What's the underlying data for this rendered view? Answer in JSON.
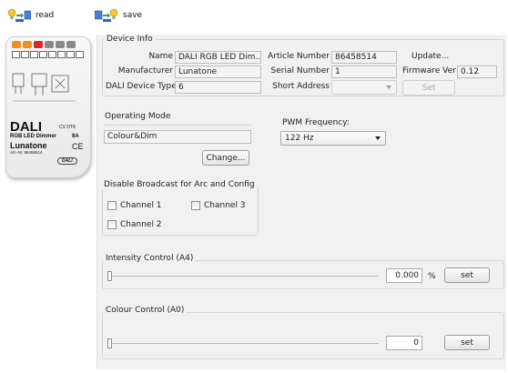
{
  "toolbar": {
    "read_label": "read",
    "save_label": "save"
  },
  "device": {
    "brand": "DALI",
    "type_code": "CV DT8",
    "product": "RGB LED Dimmer",
    "current": "8A",
    "maker": "Lunatone",
    "article": "Art.-Nr. 86458514",
    "ce": "CE",
    "dali_badge": "DALI"
  },
  "device_info": {
    "title": "Device Info",
    "name_label": "Name",
    "name_value": "DALI RGB LED Dim...",
    "manufacturer_label": "Manufacturer",
    "manufacturer_value": "Lunatone",
    "device_type_label": "DALI Device Type",
    "device_type_value": "6",
    "article_label": "Article Number",
    "article_value": "86458514",
    "serial_label": "Serial Number",
    "serial_value": "1",
    "short_address_label": "Short Address",
    "short_address_value": "",
    "update_label": "Update...",
    "firmware_label": "Firmware Ver",
    "firmware_value": "0.12",
    "set_label": "Set"
  },
  "operating_mode": {
    "title": "Operating Mode",
    "value": "Colour&Dim",
    "change_label": "Change..."
  },
  "pwm": {
    "label": "PWM Frequency:",
    "selected": "122 Hz"
  },
  "broadcast": {
    "title": "Disable Broadcast  for Arc and Config",
    "channels": [
      {
        "label": "Channel 1",
        "checked": false
      },
      {
        "label": "Channel 3",
        "checked": false
      },
      {
        "label": "Channel 2",
        "checked": false
      }
    ]
  },
  "intensity": {
    "title": "Intensity Control (A4)",
    "value": "0.000",
    "unit": "%",
    "set_label": "set",
    "slider_level": 0
  },
  "colour": {
    "title": "Colour Control (A0)",
    "value": "0",
    "set_label": "set",
    "slider_level": 0
  }
}
